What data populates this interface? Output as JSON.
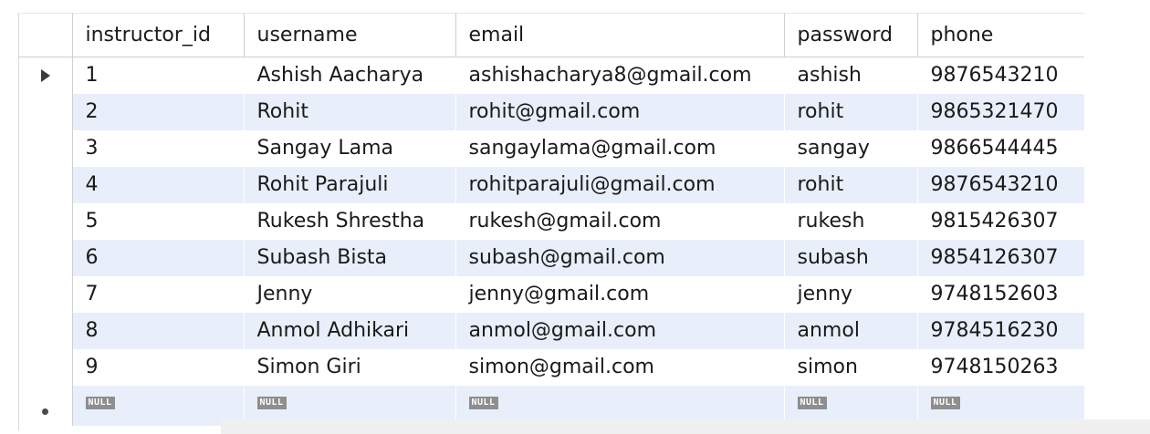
{
  "grid": {
    "columns": [
      "instructor_id",
      "username",
      "email",
      "password",
      "phone"
    ],
    "rows": [
      {
        "instructor_id": "1",
        "username": "Ashish Aacharya",
        "email": "ashishacharya8@gmail.com",
        "password": "ashish",
        "phone": "9876543210"
      },
      {
        "instructor_id": "2",
        "username": "Rohit",
        "email": "rohit@gmail.com",
        "password": "rohit",
        "phone": "9865321470"
      },
      {
        "instructor_id": "3",
        "username": "Sangay Lama",
        "email": "sangaylama@gmail.com",
        "password": "sangay",
        "phone": "9866544445"
      },
      {
        "instructor_id": "4",
        "username": "Rohit Parajuli",
        "email": "rohitparajuli@gmail.com",
        "password": "rohit",
        "phone": "9876543210"
      },
      {
        "instructor_id": "5",
        "username": "Rukesh Shrestha",
        "email": "rukesh@gmail.com",
        "password": "rukesh",
        "phone": "9815426307"
      },
      {
        "instructor_id": "6",
        "username": "Subash Bista",
        "email": "subash@gmail.com",
        "password": "subash",
        "phone": "9854126307"
      },
      {
        "instructor_id": "7",
        "username": "Jenny",
        "email": "jenny@gmail.com",
        "password": "jenny",
        "phone": "9748152603"
      },
      {
        "instructor_id": "8",
        "username": "Anmol Adhikari",
        "email": "anmol@gmail.com",
        "password": "anmol",
        "phone": "9784516230"
      },
      {
        "instructor_id": "9",
        "username": "Simon Giri",
        "email": "simon@gmail.com",
        "password": "simon",
        "phone": "9748150263"
      }
    ],
    "current_row_index": 0,
    "current_row_icon": "row-pointer-arrow-icon",
    "new_row_icon": "new-row-dot-icon",
    "null_label": "NULL",
    "alt_row_color": "#e8effa"
  }
}
